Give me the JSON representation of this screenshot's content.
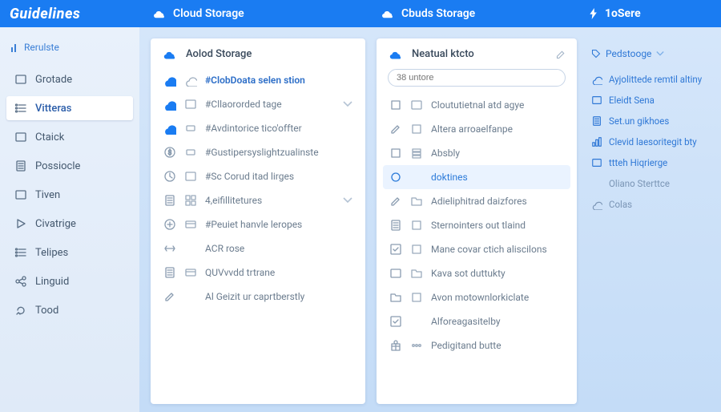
{
  "topbar": {
    "brand": "Guidelines",
    "seg1": "Cloud Storage",
    "seg2": "Cbuds Storage",
    "seg3": "1oSere"
  },
  "leftnav": {
    "top": "Rerulste",
    "items": [
      {
        "label": "Grotade"
      },
      {
        "label": "Vitteras",
        "selected": true
      },
      {
        "label": "Ctaick"
      },
      {
        "label": "Possiocle"
      },
      {
        "label": "Tiven"
      },
      {
        "label": "Civatrige"
      },
      {
        "label": "Telipes"
      },
      {
        "label": "Linguid"
      },
      {
        "label": "Tood"
      }
    ]
  },
  "panel_a": {
    "title": "Aolod Storage",
    "rows": [
      {
        "label": "#ClobDoata selen stion",
        "icons": [
          "cloud",
          "cloud"
        ],
        "strong": true
      },
      {
        "label": "#Cllaororded tage",
        "icons": [
          "cloud",
          "box"
        ],
        "chev": true
      },
      {
        "label": "#Avdintorice tico'offter",
        "icons": [
          "cloud",
          "tag"
        ]
      },
      {
        "label": "#Gustipersyslightzualinste",
        "icons": [
          "dollar",
          "tag"
        ]
      },
      {
        "label": "#Sc Corud itad lirges",
        "icons": [
          "clock",
          "box"
        ]
      },
      {
        "label": "4,eifillitetures",
        "icons": [
          "doc",
          "grid"
        ],
        "chev": true
      },
      {
        "label": "#Peuiet hanvle leropes",
        "icons": [
          "plus",
          "card"
        ]
      },
      {
        "label": "ACR rose",
        "icons": [
          "arrows",
          "none"
        ]
      },
      {
        "label": "QUVvvdd trtrane",
        "icons": [
          "doc",
          "card"
        ]
      },
      {
        "label": "Al Geizit ur caprtberstly",
        "icons": [
          "edit",
          "none"
        ]
      }
    ]
  },
  "panel_b": {
    "title": "Neatual ktcto",
    "search_placeholder": "38 untore",
    "rows": [
      {
        "label": "Cloututietnal atd agye",
        "icons": [
          "square",
          "box"
        ]
      },
      {
        "label": "Altera arroaelfanpe",
        "icons": [
          "edit",
          "square"
        ]
      },
      {
        "label": "Absbly",
        "icons": [
          "square",
          "stack"
        ]
      },
      {
        "label": "doktines",
        "icons": [
          "circle",
          "none"
        ],
        "hl": true
      },
      {
        "label": "Adieliphitrad daizfores",
        "icons": [
          "edit",
          "folder"
        ]
      },
      {
        "label": "Sternointers out tlaind",
        "icons": [
          "doc",
          "square"
        ]
      },
      {
        "label": "Mane covar ctich aliscilons",
        "icons": [
          "check",
          "square"
        ]
      },
      {
        "label": "Kava sot duttukty",
        "icons": [
          "box",
          "folder"
        ]
      },
      {
        "label": "Avon motownlorkiclate",
        "icons": [
          "folder",
          "square"
        ]
      },
      {
        "label": "Alforeagasitelby",
        "icons": [
          "check",
          "none"
        ]
      },
      {
        "label": "Pedigitand butte",
        "icons": [
          "gift",
          "dots"
        ]
      }
    ]
  },
  "rightcol": {
    "top": "Pedstooge",
    "links": [
      {
        "label": "Ayjolittede remtil altiny",
        "icon": "cloud"
      },
      {
        "label": "Eleidt Sena",
        "icon": "box"
      },
      {
        "label": "Set.un gikhoes",
        "icon": "doc"
      },
      {
        "label": "Clevid laesoritegit bty",
        "icon": "bars"
      },
      {
        "label": "ttteh Hiqrierge",
        "icon": "box"
      },
      {
        "label": "Oliano Sterttce",
        "icon": "none",
        "muted": true
      },
      {
        "label": "Colas",
        "icon": "cloud",
        "muted": true
      }
    ]
  },
  "colors": {
    "accent": "#1a7cf2"
  }
}
